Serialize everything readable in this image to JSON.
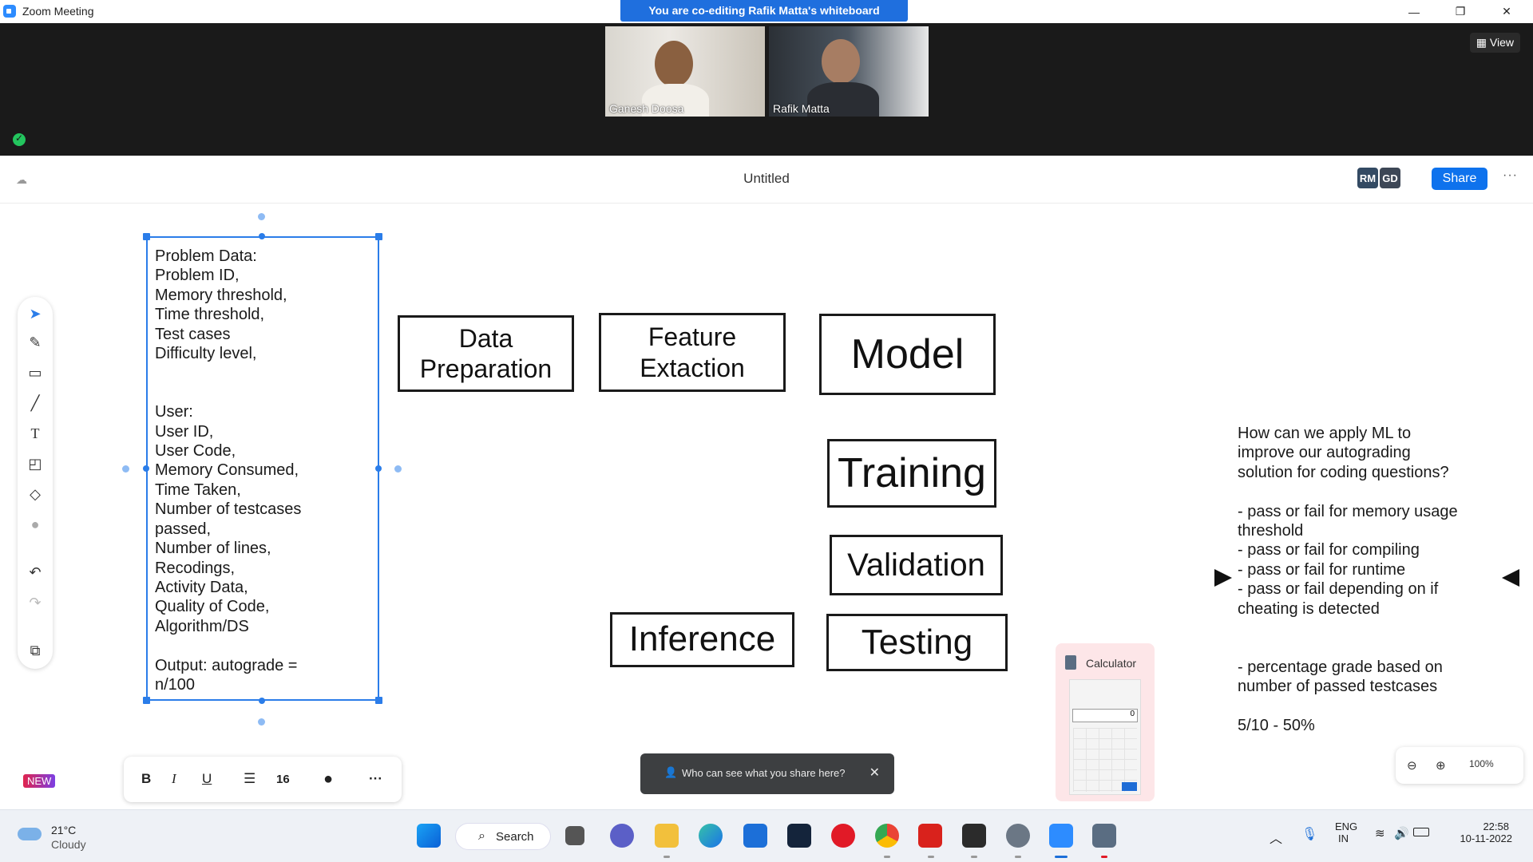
{
  "window": {
    "title": "Zoom Meeting",
    "banner": "You are co-editing Rafik Matta's whiteboard",
    "controls": {
      "minimize": "—",
      "restore": "❐",
      "close": "✕"
    }
  },
  "participants": [
    {
      "name": "Ganesh Doosa"
    },
    {
      "name": "Rafik Matta"
    }
  ],
  "view_button": "View",
  "whiteboard": {
    "title": "Untitled",
    "avatars": [
      "RM",
      "GD"
    ],
    "share_label": "Share",
    "more_label": "···"
  },
  "canvas": {
    "selected_text": "Problem Data:\nProblem ID,\nMemory threshold,\nTime threshold,\nTest cases\nDifficulty level,\n\n\nUser:\nUser ID,\nUser Code,\nMemory Consumed,\nTime Taken,\nNumber of testcases\npassed,\nNumber of lines,\nRecodings,\nActivity Data,\nQuality of Code,\nAlgorithm/DS\n\nOutput: autograde =\nn/100",
    "boxes": [
      {
        "id": "data-preparation",
        "label": "Data\nPreparation"
      },
      {
        "id": "feature-extaction",
        "label": "Feature\nExtaction"
      },
      {
        "id": "model",
        "label": "Model"
      },
      {
        "id": "training",
        "label": "Training"
      },
      {
        "id": "validation",
        "label": "Validation"
      },
      {
        "id": "inference",
        "label": "Inference"
      },
      {
        "id": "testing",
        "label": "Testing"
      }
    ],
    "right_text": "How can we apply ML to\nimprove our autograding\nsolution for coding questions?\n\n- pass or fail for memory usage\nthreshold\n- pass or fail for compiling\n- pass or fail for runtime\n- pass or fail depending on if\ncheating is detected\n\n\n- percentage grade based on\nnumber of passed testcases\n\n5/10 - 50%"
  },
  "format_toolbar": {
    "bold": "B",
    "italic": "I",
    "underline": "U",
    "font_size": "16",
    "more": "···"
  },
  "new_badge": "NEW",
  "share_tip": "Who can see what you share here?",
  "zoom": {
    "level": "100%"
  },
  "calculator_preview": {
    "title": "Calculator",
    "display": "0"
  },
  "taskbar": {
    "weather_temp": "21°C",
    "weather_desc": "Cloudy",
    "search_label": "Search",
    "lang_line1": "ENG",
    "lang_line2": "IN",
    "time": "22:58",
    "date": "10-11-2022"
  },
  "colors": {
    "banner": "#1f6fde",
    "share_button": "#0e72ed",
    "selection": "#2b7de9",
    "video_strip": "#1a1a1a"
  }
}
